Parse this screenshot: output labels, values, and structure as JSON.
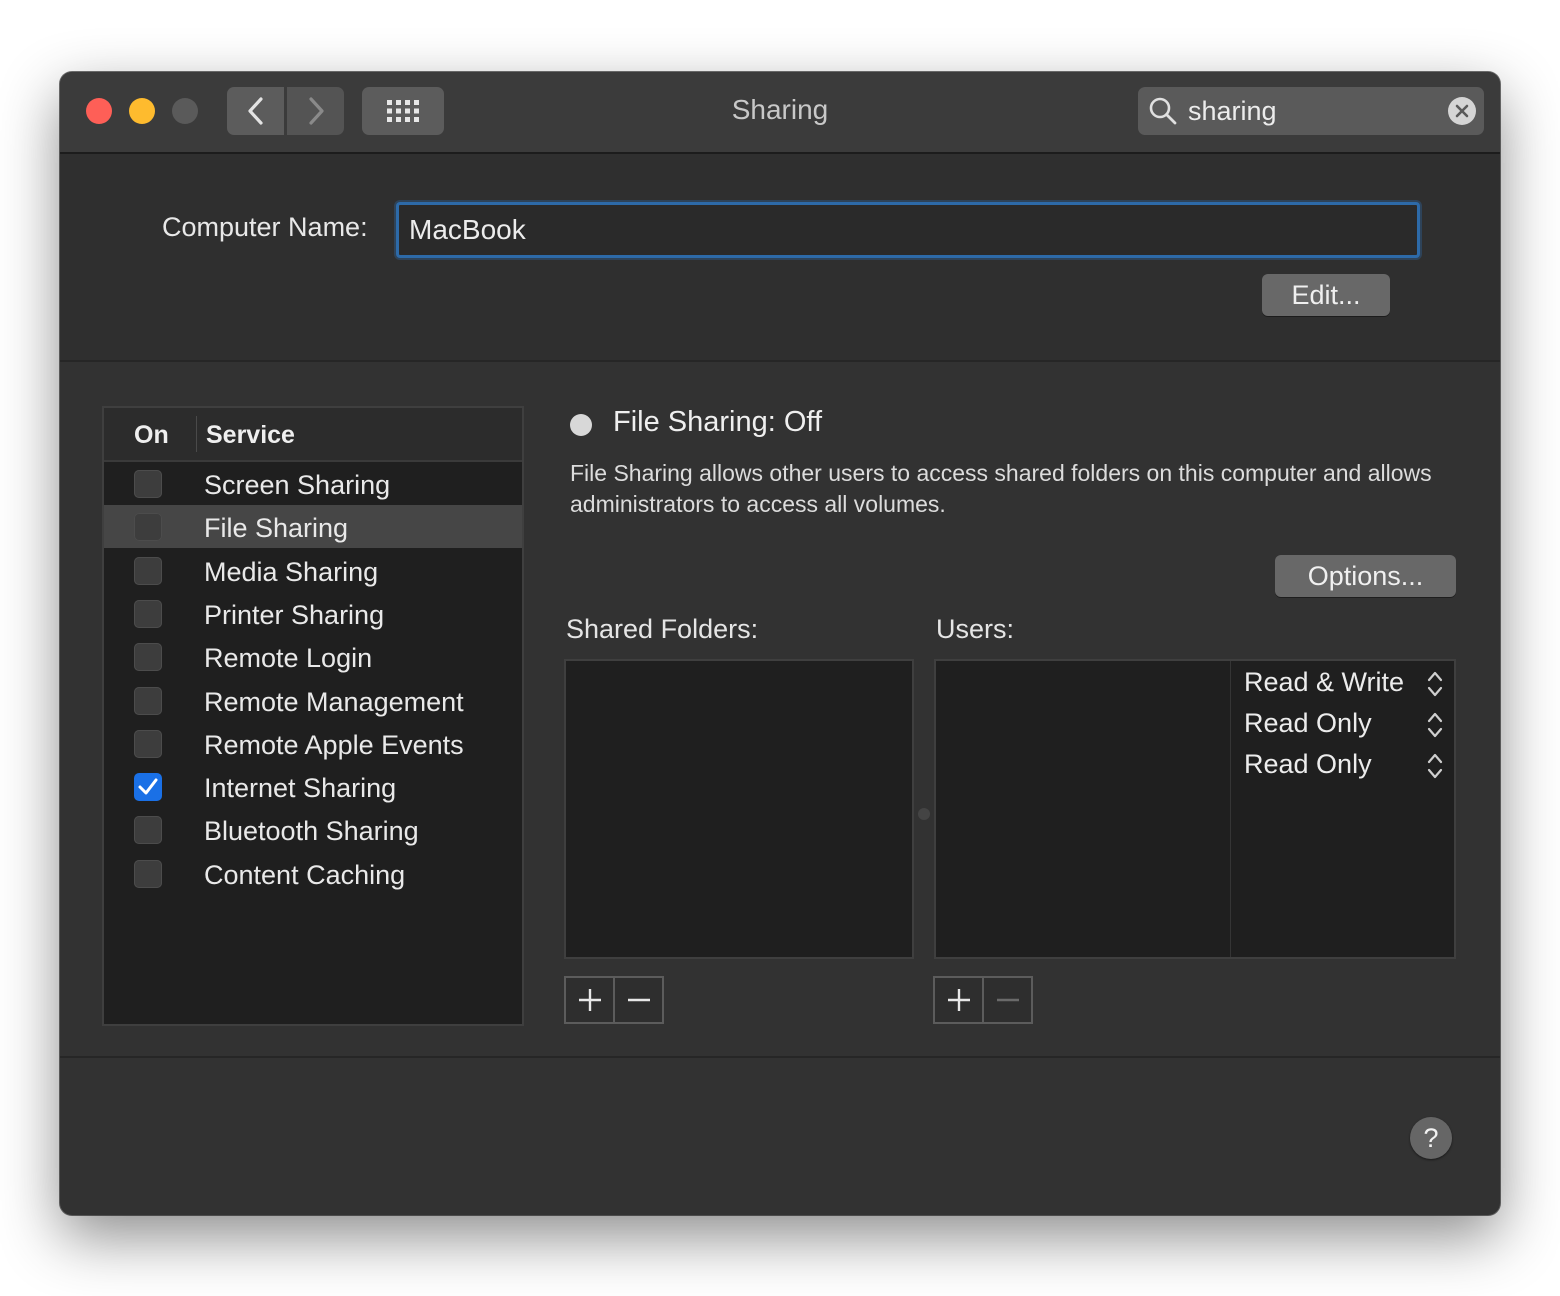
{
  "window": {
    "title": "Sharing"
  },
  "search": {
    "value": "sharing"
  },
  "computer_name": {
    "label": "Computer Name:",
    "value": "MacBook",
    "edit_button": "Edit..."
  },
  "services": {
    "header_on": "On",
    "header_service": "Service",
    "items": [
      {
        "label": "Screen Sharing",
        "checked": false
      },
      {
        "label": "File Sharing",
        "checked": false,
        "selected": true
      },
      {
        "label": "Media Sharing",
        "checked": false
      },
      {
        "label": "Printer Sharing",
        "checked": false
      },
      {
        "label": "Remote Login",
        "checked": false
      },
      {
        "label": "Remote Management",
        "checked": false
      },
      {
        "label": "Remote Apple Events",
        "checked": false
      },
      {
        "label": "Internet Sharing",
        "checked": true
      },
      {
        "label": "Bluetooth Sharing",
        "checked": false
      },
      {
        "label": "Content Caching",
        "checked": false
      }
    ]
  },
  "detail": {
    "status": "File Sharing: Off",
    "description": "File Sharing allows other users to access shared folders on this computer and allows administrators to access all volumes.",
    "options_button": "Options...",
    "shared_folders_label": "Shared Folders:",
    "users_label": "Users:",
    "permissions": [
      "Read & Write",
      "Read Only",
      "Read Only"
    ]
  },
  "colors": {
    "accent": "#1a70e6",
    "focus_ring": "#2d6aa8",
    "window_bg": "#323232"
  },
  "icons": {
    "back": "chevron-left-icon",
    "forward": "chevron-right-icon",
    "grid": "grid-icon",
    "search": "search-icon",
    "clear": "clear-icon",
    "add": "plus-icon",
    "remove": "minus-icon",
    "help": "question-icon"
  }
}
